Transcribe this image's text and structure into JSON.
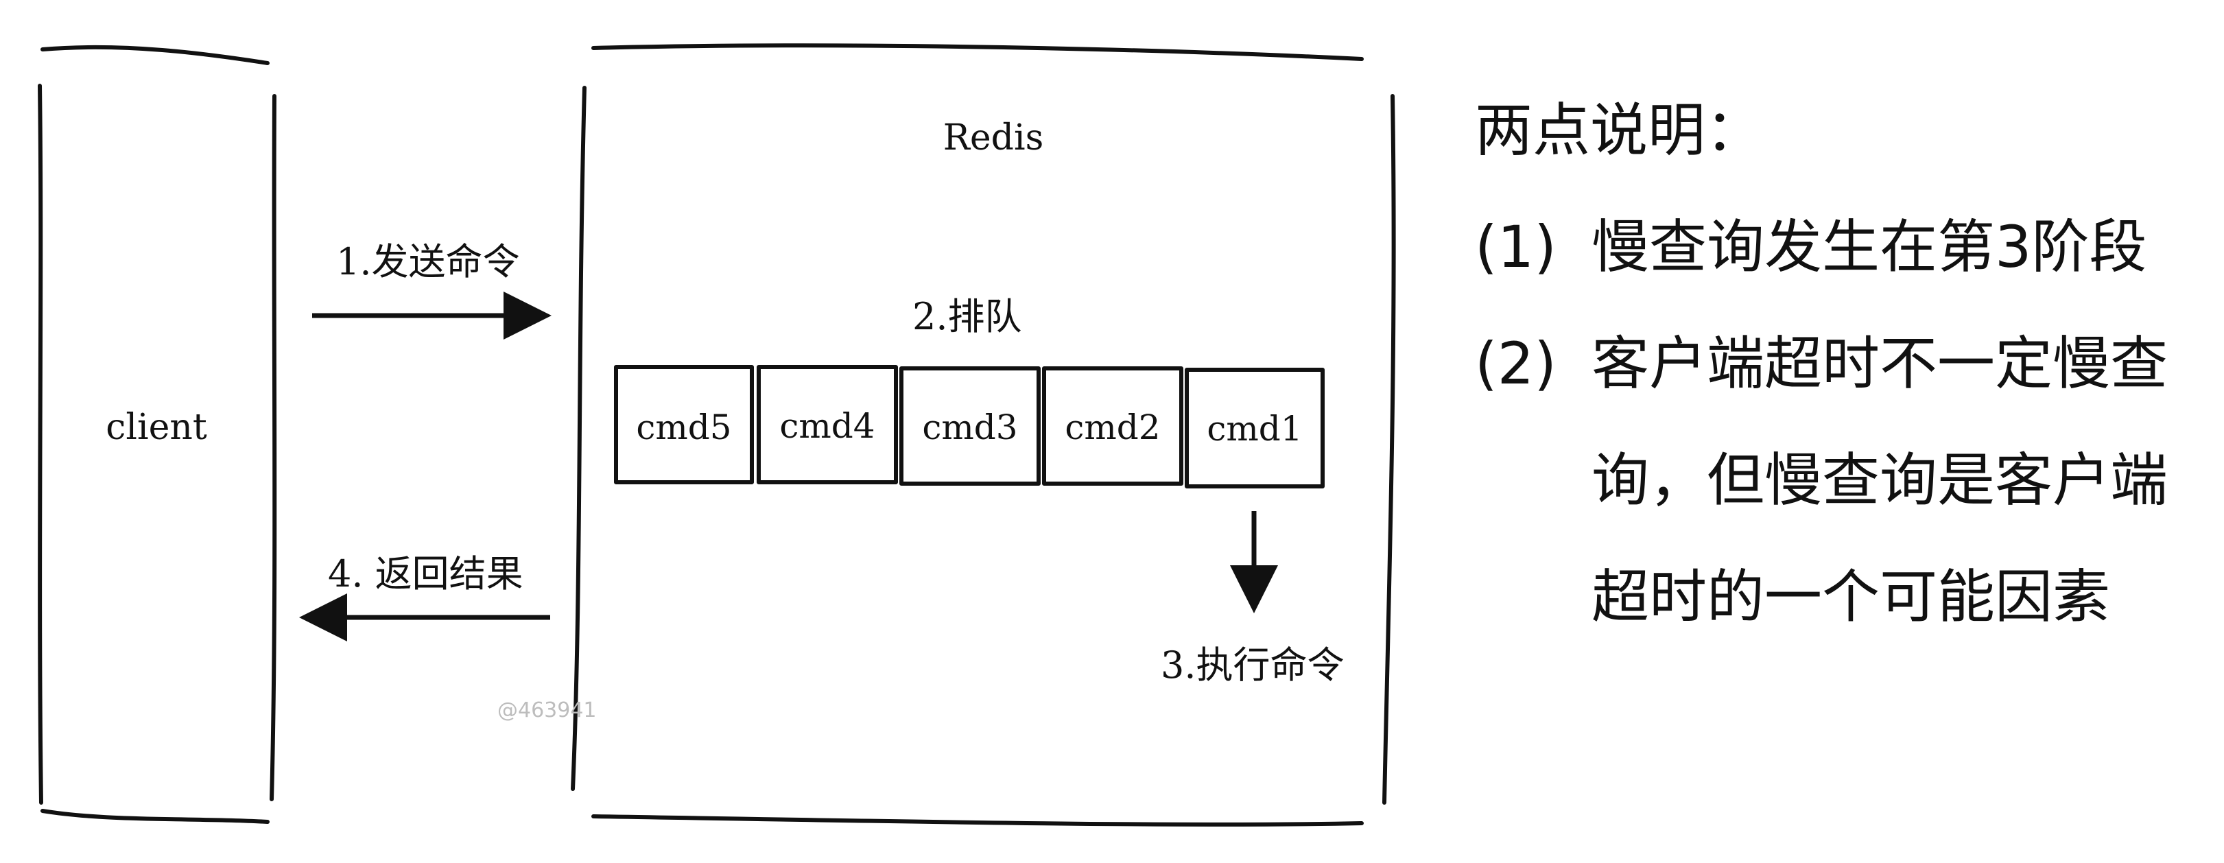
{
  "diagram": {
    "client_label": "client",
    "redis_label": "Redis",
    "step1_label": "1.发送命令",
    "step2_label": "2.排队",
    "step3_label": "3.执行命令",
    "step4_label": "4. 返回结果",
    "queue": [
      "cmd5",
      "cmd4",
      "cmd3",
      "cmd2",
      "cmd1"
    ],
    "watermark": "@463941"
  },
  "notes": {
    "heading": "两点说明：",
    "items": [
      {
        "number": "(1)",
        "text": "慢查询发生在第3阶段"
      },
      {
        "number": "(2)",
        "text": "客户端超时不一定慢查询，但慢查询是客户端超时的一个可能因素"
      }
    ]
  }
}
